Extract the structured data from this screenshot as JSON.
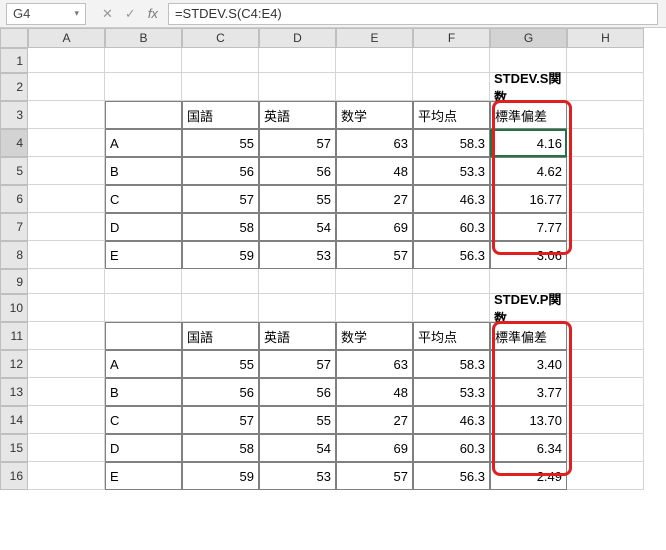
{
  "namebox": "G4",
  "formula": "=STDEV.S(C4:E4)",
  "col_headers": [
    "A",
    "B",
    "C",
    "D",
    "E",
    "F",
    "G",
    "H"
  ],
  "row_headers": [
    "1",
    "2",
    "3",
    "4",
    "5",
    "6",
    "7",
    "8",
    "9",
    "10",
    "11",
    "12",
    "13",
    "14",
    "15",
    "16"
  ],
  "labels": {
    "stdev_s_title": "STDEV.S関数",
    "stdev_p_title": "STDEV.P関数",
    "col_kokugo": "国語",
    "col_eigo": "英語",
    "col_sugaku": "数学",
    "col_avg": "平均点",
    "col_stdev": "標準偏差"
  },
  "table_s": [
    {
      "name": "A",
      "kokugo": "55",
      "eigo": "57",
      "sugaku": "63",
      "avg": "58.3",
      "stdev": "4.16"
    },
    {
      "name": "B",
      "kokugo": "56",
      "eigo": "56",
      "sugaku": "48",
      "avg": "53.3",
      "stdev": "4.62"
    },
    {
      "name": "C",
      "kokugo": "57",
      "eigo": "55",
      "sugaku": "27",
      "avg": "46.3",
      "stdev": "16.77"
    },
    {
      "name": "D",
      "kokugo": "58",
      "eigo": "54",
      "sugaku": "69",
      "avg": "60.3",
      "stdev": "7.77"
    },
    {
      "name": "E",
      "kokugo": "59",
      "eigo": "53",
      "sugaku": "57",
      "avg": "56.3",
      "stdev": "3.06"
    }
  ],
  "table_p": [
    {
      "name": "A",
      "kokugo": "55",
      "eigo": "57",
      "sugaku": "63",
      "avg": "58.3",
      "stdev": "3.40"
    },
    {
      "name": "B",
      "kokugo": "56",
      "eigo": "56",
      "sugaku": "48",
      "avg": "53.3",
      "stdev": "3.77"
    },
    {
      "name": "C",
      "kokugo": "57",
      "eigo": "55",
      "sugaku": "27",
      "avg": "46.3",
      "stdev": "13.70"
    },
    {
      "name": "D",
      "kokugo": "58",
      "eigo": "54",
      "sugaku": "69",
      "avg": "60.3",
      "stdev": "6.34"
    },
    {
      "name": "E",
      "kokugo": "59",
      "eigo": "53",
      "sugaku": "57",
      "avg": "56.3",
      "stdev": "2.49"
    }
  ],
  "active_cell": "G4"
}
